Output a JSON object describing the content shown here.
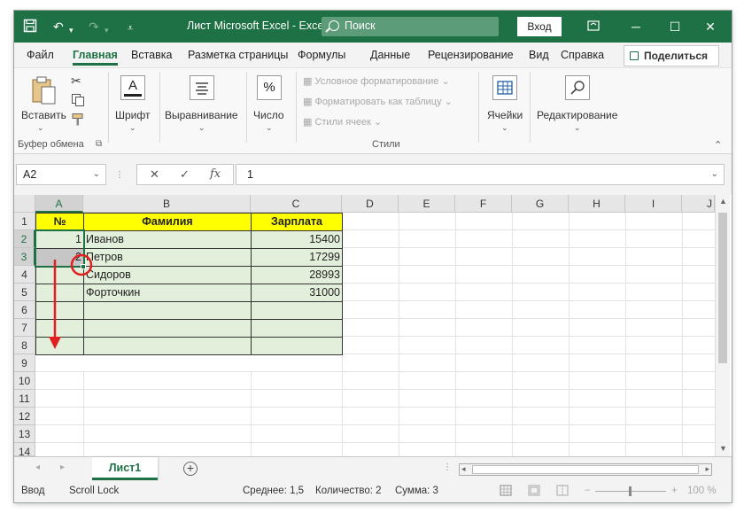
{
  "window": {
    "title": "Лист Microsoft Excel  -  Excel",
    "search_placeholder": "Поиск",
    "login_label": "Вход"
  },
  "menu": {
    "tabs": [
      "Файл",
      "Главная",
      "Вставка",
      "Разметка страницы",
      "Формулы",
      "Данные",
      "Рецензирование",
      "Вид",
      "Справка"
    ],
    "active": "Главная",
    "share_label": "Поделиться"
  },
  "ribbon": {
    "paste_label": "Вставить",
    "clipboard_group": "Буфер обмена",
    "font_label": "Шрифт",
    "align_label": "Выравнивание",
    "number_label": "Число",
    "number_icon_text": "%",
    "cond_format": "Условное форматирование",
    "format_table": "Форматировать как таблицу",
    "cell_styles": "Стили ячеек",
    "styles_group": "Стили",
    "cells_label": "Ячейки",
    "editing_label": "Редактирование"
  },
  "formula_bar": {
    "name_box": "A2",
    "value": "1",
    "cancel": "✕",
    "enter": "✓",
    "fx": "fx"
  },
  "grid": {
    "columns": [
      "A",
      "B",
      "C",
      "D",
      "E",
      "F",
      "G",
      "H",
      "I",
      "J"
    ],
    "selected_column": "A",
    "rows": [
      "1",
      "2",
      "3",
      "4",
      "5",
      "6",
      "7",
      "8",
      "9",
      "10",
      "11",
      "12",
      "13",
      "14"
    ],
    "header": [
      "№",
      "Фамилия",
      "Зарплата"
    ],
    "records": [
      {
        "num": "1",
        "name": "Иванов",
        "salary": "15400"
      },
      {
        "num": "2",
        "name": "Петров",
        "salary": "17299"
      },
      {
        "num": "",
        "name": "Сидоров",
        "salary": "28993"
      },
      {
        "num": "",
        "name": "Форточкин",
        "salary": "31000"
      }
    ]
  },
  "sheets": {
    "active": "Лист1",
    "add_label": "+"
  },
  "status": {
    "mode": "Ввод",
    "scroll_lock": "Scroll Lock",
    "average": "Среднее: 1,5",
    "count": "Количество: 2",
    "sum": "Сумма: 3",
    "zoom": "100 %"
  },
  "colors": {
    "accent": "#1e7145",
    "header_fill": "#ffff00",
    "table_fill": "#e2efda",
    "annotation": "#e02020"
  }
}
